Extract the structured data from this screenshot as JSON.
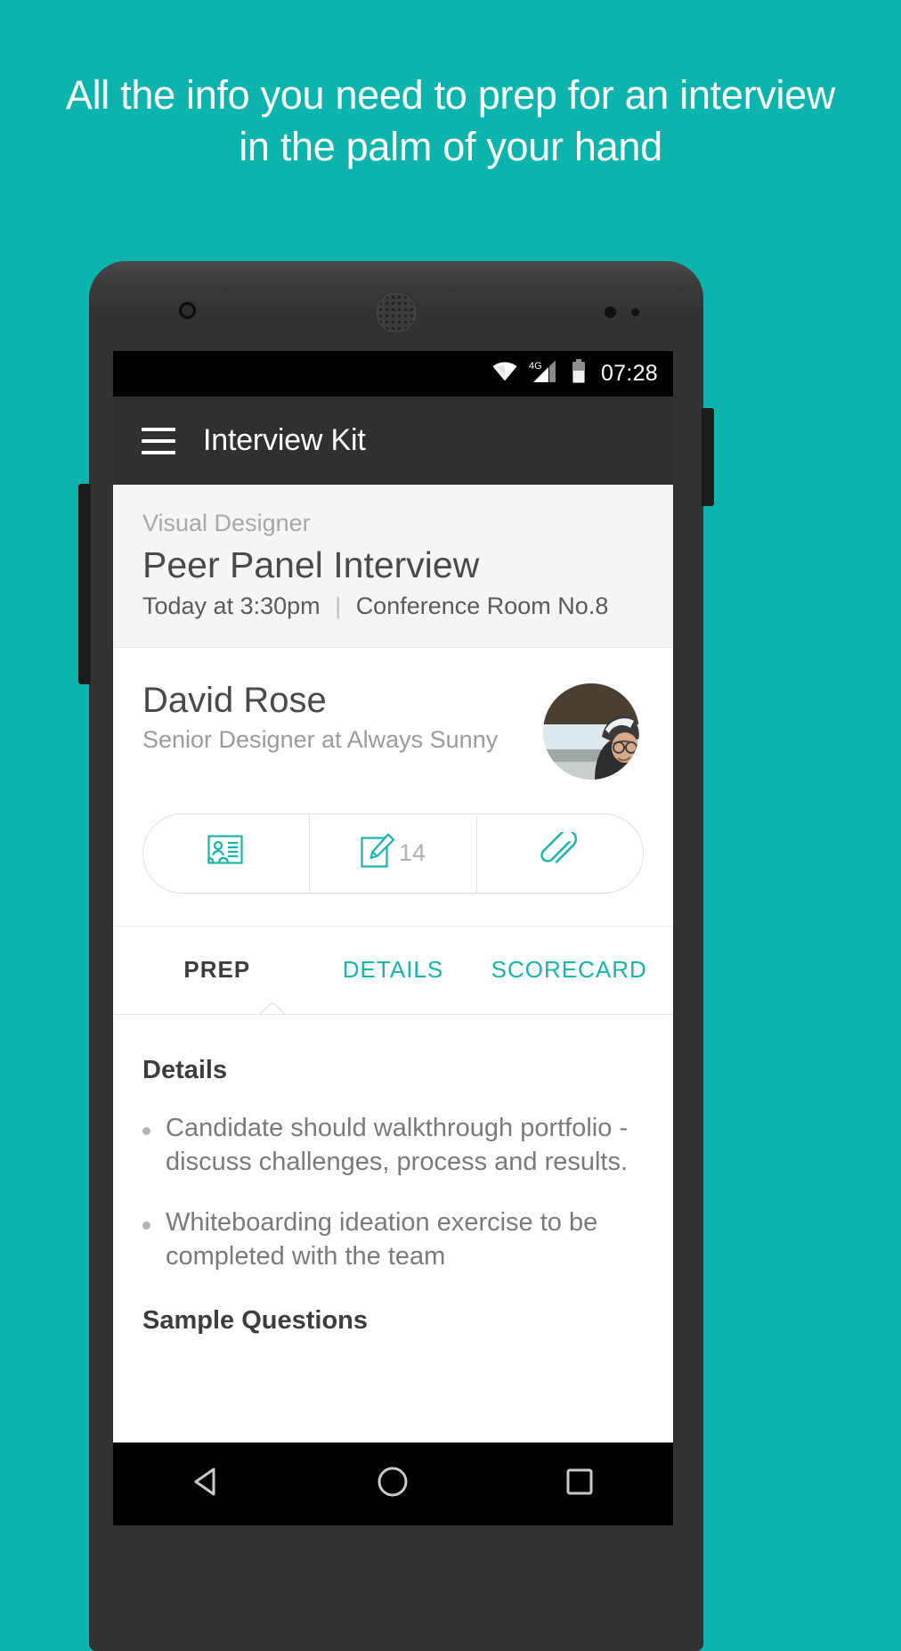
{
  "promo": {
    "headline": "All the info you need to prep for an interview in the palm of your hand",
    "background_color": "#0bb5ae"
  },
  "accent_color": "#16b5ab",
  "statusbar": {
    "wifi_icon": "wifi-icon",
    "network_label": "4G",
    "signal_icon": "signal-icon",
    "battery_icon": "battery-icon",
    "time": "07:28"
  },
  "appbar": {
    "menu_icon": "hamburger-menu-icon",
    "title": "Interview Kit"
  },
  "interview": {
    "role": "Visual Designer",
    "title": "Peer Panel Interview",
    "time": "Today at 3:30pm",
    "separator": "|",
    "location": "Conference Room No.8"
  },
  "candidate": {
    "name": "David Rose",
    "subtitle": "Senior Designer at Always Sunny",
    "avatar_name": "candidate-avatar"
  },
  "actions": [
    {
      "icon": "contact-card-icon",
      "count": ""
    },
    {
      "icon": "note-edit-icon",
      "count": "14"
    },
    {
      "icon": "paperclip-icon",
      "count": ""
    }
  ],
  "tabs": [
    {
      "label": "PREP",
      "active": true
    },
    {
      "label": "DETAILS",
      "active": false
    },
    {
      "label": "SCORECARD",
      "active": false
    }
  ],
  "prep": {
    "details_heading": "Details",
    "bullets": [
      "Candidate should walkthrough portfolio - discuss challenges, process and results.",
      "Whiteboarding ideation exercise to be completed with the team"
    ],
    "questions_heading": "Sample Questions"
  },
  "navbar": {
    "back_icon": "back-triangle-icon",
    "home_icon": "home-circle-icon",
    "recents_icon": "recents-square-icon"
  },
  "hardware": {
    "camera": "front-camera",
    "speaker": "earpiece-speaker",
    "sensors": "proximity-sensors",
    "volume_button": "volume-button",
    "power_button": "power-button"
  }
}
